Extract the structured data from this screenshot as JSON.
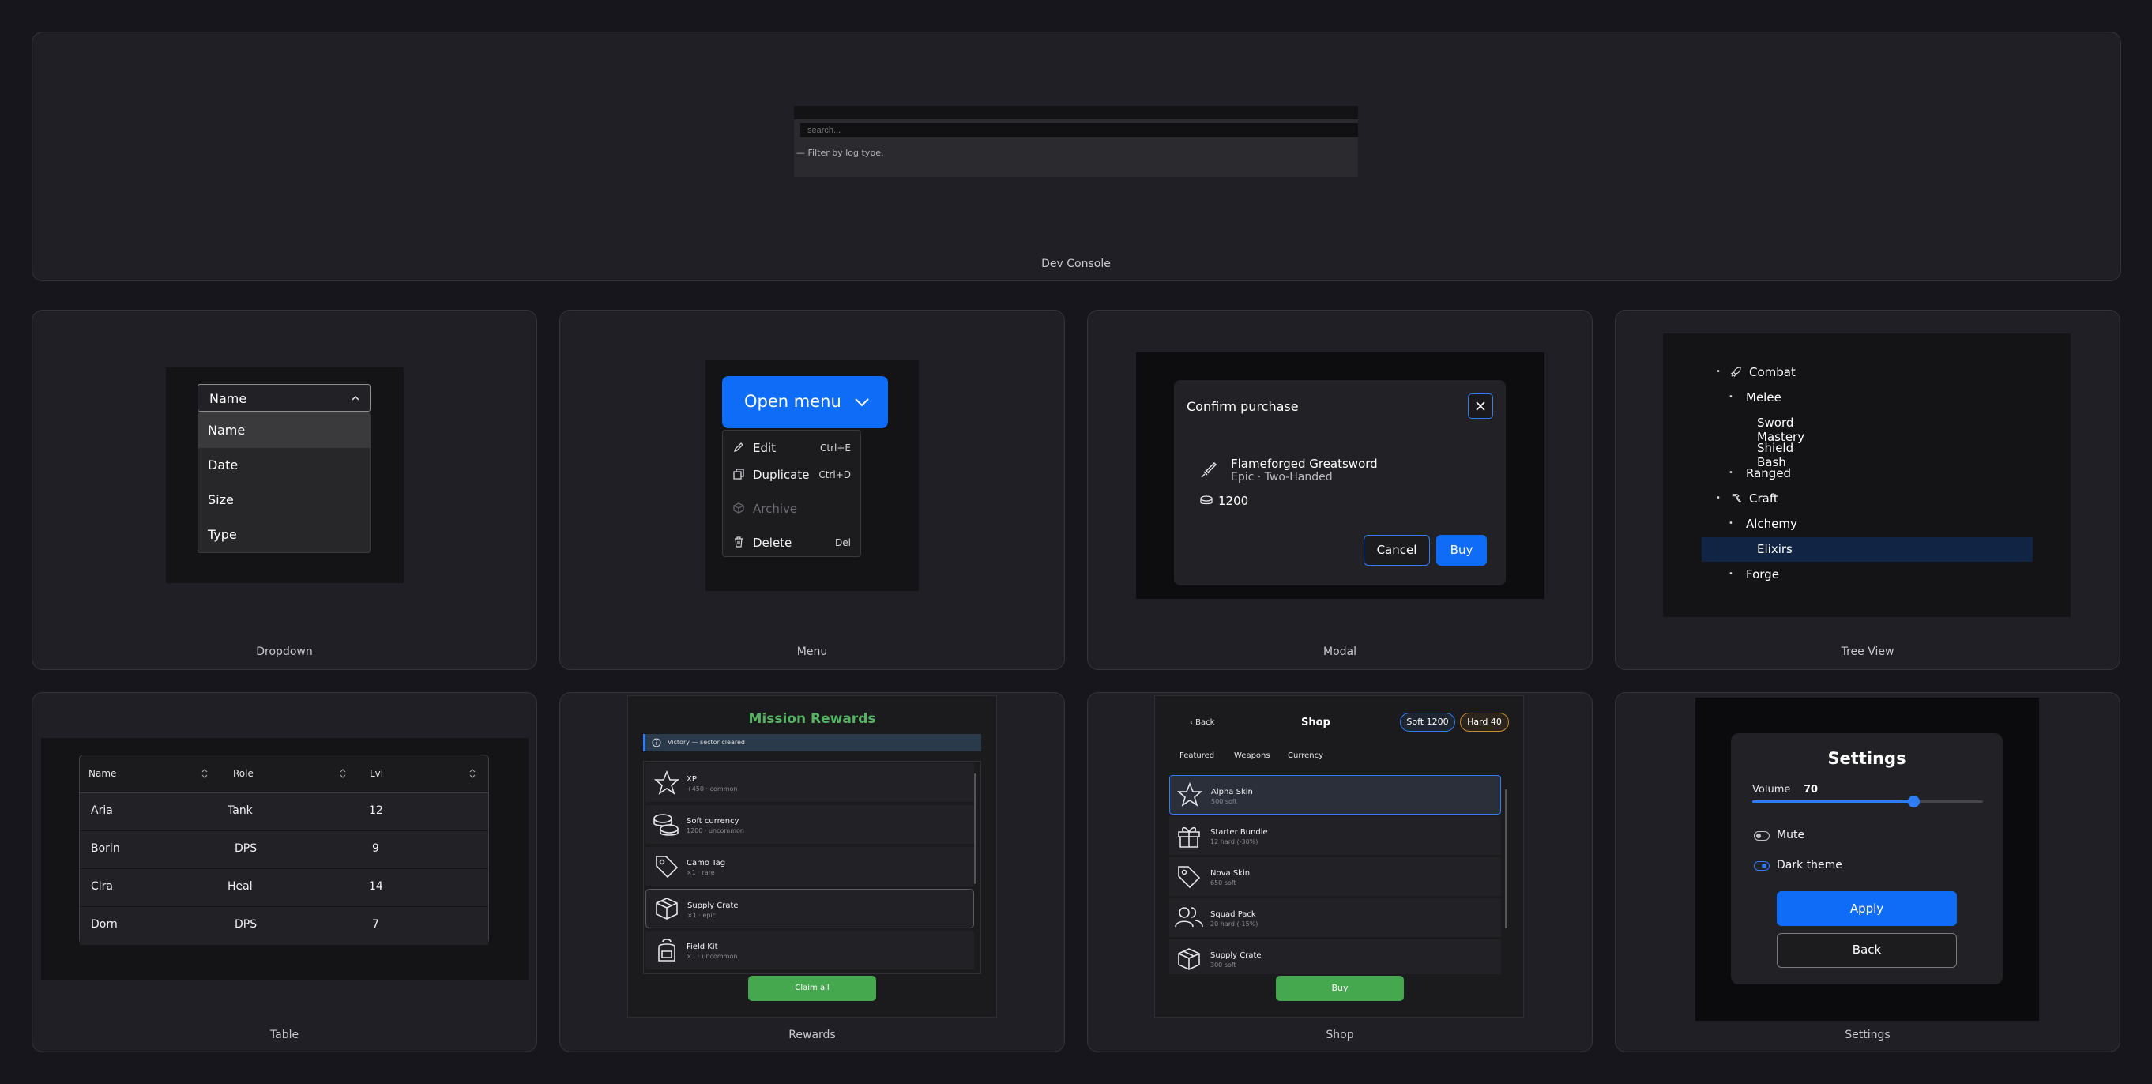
{
  "dev_console": {
    "label": "Dev Console",
    "search_placeholder": "search...",
    "hint": "— Filter by log type."
  },
  "dropdown": {
    "label": "Dropdown",
    "selected": "Name",
    "options": [
      "Name",
      "Date",
      "Size",
      "Type"
    ]
  },
  "menu": {
    "label": "Menu",
    "button_label": "Open menu",
    "items": [
      {
        "label": "Edit",
        "shortcut": "Ctrl+E",
        "icon": "pencil-icon"
      },
      {
        "label": "Duplicate",
        "shortcut": "Ctrl+D",
        "icon": "copy-icon"
      },
      {
        "label": "Archive",
        "shortcut": "",
        "icon": "archive-box-icon",
        "disabled": true
      },
      {
        "label": "Delete",
        "shortcut": "Del",
        "icon": "trash-icon"
      }
    ]
  },
  "modal": {
    "label": "Modal",
    "title": "Confirm purchase",
    "item_name": "Flameforged Greatsword",
    "item_sub": "Epic · Two-Handed",
    "price": "1200",
    "cancel": "Cancel",
    "buy": "Buy"
  },
  "tree": {
    "label": "Tree View",
    "nodes": [
      {
        "label": "Combat",
        "depth": 0,
        "bullet": true,
        "icon": "rocket-icon"
      },
      {
        "label": "Melee",
        "depth": 1,
        "bullet": true
      },
      {
        "label": "Sword Mastery",
        "depth": 2,
        "bullet": false
      },
      {
        "label": "Shield Bash",
        "depth": 2,
        "bullet": false
      },
      {
        "label": "Ranged",
        "depth": 1,
        "bullet": true
      },
      {
        "label": "Craft",
        "depth": 0,
        "bullet": true,
        "icon": "hammer-icon"
      },
      {
        "label": "Alchemy",
        "depth": 1,
        "bullet": true
      },
      {
        "label": "Elixirs",
        "depth": 2,
        "bullet": false,
        "selected": true
      },
      {
        "label": "Forge",
        "depth": 1,
        "bullet": true
      }
    ]
  },
  "table": {
    "label": "Table",
    "headers": [
      "Name",
      "Role",
      "Lvl"
    ],
    "rows": [
      [
        "Aria",
        "Tank",
        "12"
      ],
      [
        "Borin",
        "DPS",
        "9"
      ],
      [
        "Cira",
        "Heal",
        "14"
      ],
      [
        "Dorn",
        "DPS",
        "7"
      ]
    ]
  },
  "rewards": {
    "label": "Rewards",
    "title": "Mission Rewards",
    "banner": "Victory — sector cleared",
    "items": [
      {
        "name": "XP",
        "sub": "+450 · common",
        "icon": "star-icon"
      },
      {
        "name": "Soft currency",
        "sub": "1200 · uncommon",
        "icon": "coins-icon"
      },
      {
        "name": "Camo Tag",
        "sub": "×1 · rare",
        "icon": "tag-icon"
      },
      {
        "name": "Supply Crate",
        "sub": "×1 · epic",
        "icon": "crate-icon",
        "highlighted": true
      },
      {
        "name": "Field Kit",
        "sub": "×1 · uncommon",
        "icon": "backpack-icon"
      }
    ],
    "claim": "Claim all"
  },
  "shop": {
    "label": "Shop",
    "back": "‹ Back",
    "title": "Shop",
    "soft": "Soft 1200",
    "hard": "Hard 40",
    "tabs": [
      "Featured",
      "Weapons",
      "Currency"
    ],
    "items": [
      {
        "name": "Alpha Skin",
        "sub": "500 soft",
        "icon": "star-icon",
        "selected": true
      },
      {
        "name": "Starter Bundle",
        "sub": "12 hard (-30%)",
        "icon": "gift-icon"
      },
      {
        "name": "Nova Skin",
        "sub": "650 soft",
        "icon": "tag-icon"
      },
      {
        "name": "Squad Pack",
        "sub": "20 hard (-15%)",
        "icon": "users-icon"
      },
      {
        "name": "Supply Crate",
        "sub": "300 soft",
        "icon": "crate-icon"
      }
    ],
    "buy": "Buy"
  },
  "settings": {
    "label": "Settings",
    "title": "Settings",
    "volume_label": "Volume",
    "volume_value": "70",
    "volume_fraction": 0.7,
    "mute_label": "Mute",
    "mute_on": false,
    "dark_label": "Dark theme",
    "dark_on": true,
    "apply": "Apply",
    "back": "Back"
  },
  "colors": {
    "accent": "#0f6cf6",
    "success": "#45a84f",
    "selection": "#112444"
  }
}
